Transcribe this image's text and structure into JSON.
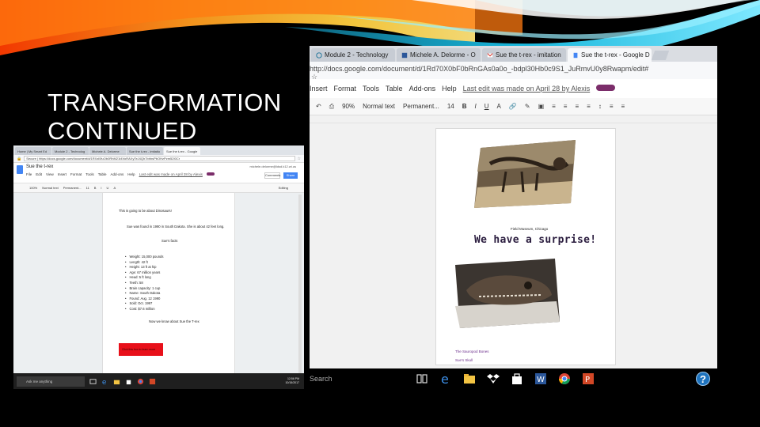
{
  "slide": {
    "title_line1": "TRANSFORMATION",
    "title_line2": "CONTINUED"
  },
  "left_screenshot": {
    "tabs": [
      "Home | My Smart Ed",
      "Module 2 - Technolog",
      "Michele A. Delorme",
      "Sue the t-rex - imitatio",
      "Sue the t-rex - Google"
    ],
    "url": "Secure | https://docs.google.com/document/d/1RXzl0fuOb0RhM21t4VoRAXyTeJ4Qh7bhhsPbOHzPzm52I0Cr",
    "doc_title": "Sue the t-rex",
    "menu": [
      "File",
      "Edit",
      "View",
      "Insert",
      "Format",
      "Tools",
      "Table",
      "Add-ons",
      "Help"
    ],
    "last_edit": "Last edit was made on April 28 by Alexis",
    "user": "michele.delorme@ldsd.k12.wi.us",
    "comments_label": "Comments",
    "share_label": "Share",
    "toolbar": [
      "100%",
      "Normal text",
      "Permanent...",
      "11",
      "B",
      "I",
      "U",
      "A",
      "Editing"
    ],
    "page": {
      "line1": "This is going to be about Dinosaurs!",
      "line2": "Sue was found in 1990 in South Dakota. She is about 42 feet long.",
      "line3": "Sue's facts",
      "facts": [
        "Weight: 15,000 pounds",
        "Length: 42 ft",
        "Height: 13 ft at hip",
        "Age: 67 million years",
        "Head: 5 ft long",
        "Teeth: 58",
        "Brain capacity: 1 cup",
        "Name: South Dakota",
        "Found: Aug. 12 1990",
        "Sold: Oct. 1997",
        "Cost: $7.6 million"
      ],
      "line4": "Now we know about Sue the T-rex",
      "red_box": "Click this box to learn more"
    },
    "taskbar": {
      "search": "Ask me anything",
      "time": "12:56 PM",
      "date": "10/15/2017"
    }
  },
  "right_screenshot": {
    "tabs": [
      "Module 2 - Technology",
      "Michele A. Delorme - O",
      "Sue the t-rex - imitation",
      "Sue the t-rex - Google D"
    ],
    "url": "http://docs.google.com/document/d/1Rd70X0bF0bRnGAs0a0o_-bdpl30Hb0c9S1_JuRmvU0y8Rwapm/edit#",
    "menu": [
      "Insert",
      "Format",
      "Tools",
      "Table",
      "Add-ons",
      "Help"
    ],
    "last_edit": "Last edit was made on April 28 by Alexis",
    "toolbar": [
      "90%",
      "Normal text",
      "Permanent...",
      "14",
      "B",
      "I",
      "U",
      "A"
    ],
    "page": {
      "small_text": "Field Museum, Chicago",
      "headline": "We have a surprise!",
      "purple1": "The Sauropod Bones",
      "purple2": "Sue's Skull"
    },
    "taskbar": {
      "search": "Search"
    }
  },
  "help_label": "?",
  "colors": {
    "background": "#000000",
    "swoosh_orange": "#f47a1f",
    "swoosh_cyan": "#1ec6e6",
    "docs_blue": "#4285f4",
    "red_box": "#e8101a",
    "purple_text": "#6a2c8a"
  }
}
